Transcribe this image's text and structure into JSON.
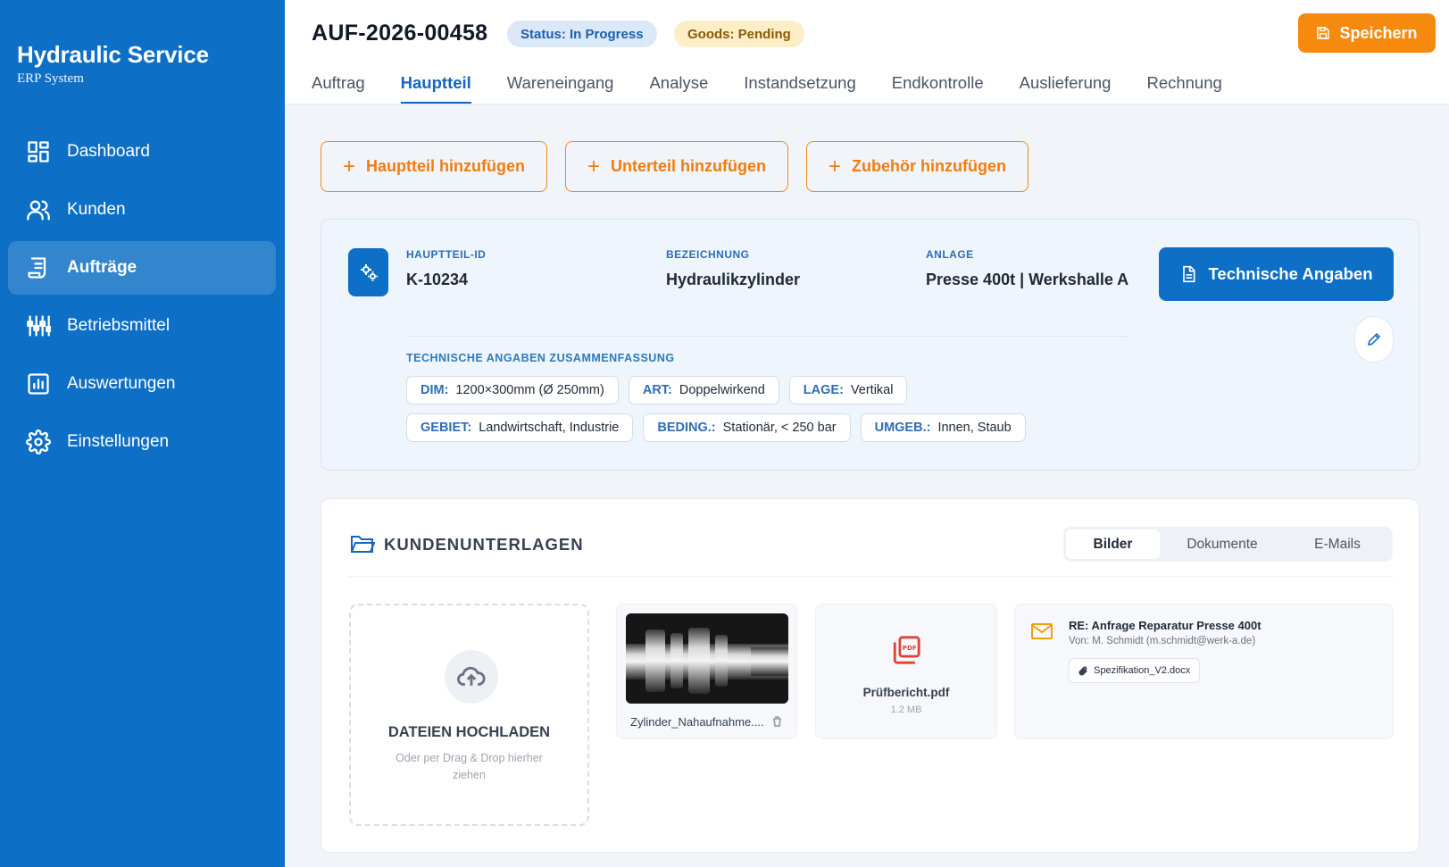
{
  "brand": {
    "title": "Hydraulic Service",
    "subtitle": "ERP System"
  },
  "sidebar": {
    "items": [
      {
        "label": "Dashboard",
        "icon": "dashboard-icon",
        "active": false
      },
      {
        "label": "Kunden",
        "icon": "users-icon",
        "active": false
      },
      {
        "label": "Aufträge",
        "icon": "orders-icon",
        "active": true
      },
      {
        "label": "Betriebsmittel",
        "icon": "equipment-icon",
        "active": false
      },
      {
        "label": "Auswertungen",
        "icon": "chart-icon",
        "active": false
      },
      {
        "label": "Einstellungen",
        "icon": "gear-icon",
        "active": false
      }
    ]
  },
  "header": {
    "order_id": "AUF-2026-00458",
    "status_badge": "Status: In Progress",
    "goods_badge": "Goods: Pending",
    "save_label": "Speichern",
    "tabs": [
      {
        "label": "Auftrag",
        "active": false
      },
      {
        "label": "Hauptteil",
        "active": true
      },
      {
        "label": "Wareneingang",
        "active": false
      },
      {
        "label": "Analyse",
        "active": false
      },
      {
        "label": "Instandsetzung",
        "active": false
      },
      {
        "label": "Endkontrolle",
        "active": false
      },
      {
        "label": "Auslieferung",
        "active": false
      },
      {
        "label": "Rechnung",
        "active": false
      }
    ]
  },
  "actions": {
    "add_main": "Hauptteil hinzufügen",
    "add_sub": "Unterteil hinzufügen",
    "add_accessory": "Zubehör hinzufügen"
  },
  "part": {
    "id_label": "HAUPTTEIL-ID",
    "id_value": "K-10234",
    "name_label": "BEZEICHNUNG",
    "name_value": "Hydraulikzylinder",
    "plant_label": "ANLAGE",
    "plant_value": "Presse 400t | Werkshalle A",
    "tech_button": "Technische Angaben",
    "summary_label": "TECHNISCHE ANGABEN ZUSAMMENFASSUNG",
    "chips_row1": [
      {
        "key": "DIM:",
        "value": "1200×300mm (Ø 250mm)"
      },
      {
        "key": "ART:",
        "value": "Doppelwirkend"
      },
      {
        "key": "LAGE:",
        "value": "Vertikal"
      }
    ],
    "chips_row2": [
      {
        "key": "GEBIET:",
        "value": "Landwirtschaft, Industrie"
      },
      {
        "key": "BEDING.:",
        "value": "Stationär, < 250 bar"
      },
      {
        "key": "UMGEB.:",
        "value": "Innen, Staub"
      }
    ]
  },
  "documents": {
    "title": "KUNDENUNTERLAGEN",
    "tabs": [
      {
        "label": "Bilder",
        "active": true
      },
      {
        "label": "Dokumente",
        "active": false
      },
      {
        "label": "E-Mails",
        "active": false
      }
    ],
    "upload_title": "DATEIEN HOCHLADEN",
    "upload_sub": "Oder per Drag & Drop hierher ziehen",
    "image_name": "Zylinder_Nahaufnahme....",
    "pdf_name": "Prüfbericht.pdf",
    "pdf_size": "1.2 MB",
    "mail_subject": "RE: Anfrage Reparatur Presse 400t",
    "mail_from": "Von: M. Schmidt (m.schmidt@werk-a.de)",
    "mail_attachment": "Spezifikation_V2.docx"
  },
  "colors": {
    "sidebar": "#0d6fc5",
    "accent_orange": "#f68a0f",
    "primary_blue": "#1565c0"
  }
}
